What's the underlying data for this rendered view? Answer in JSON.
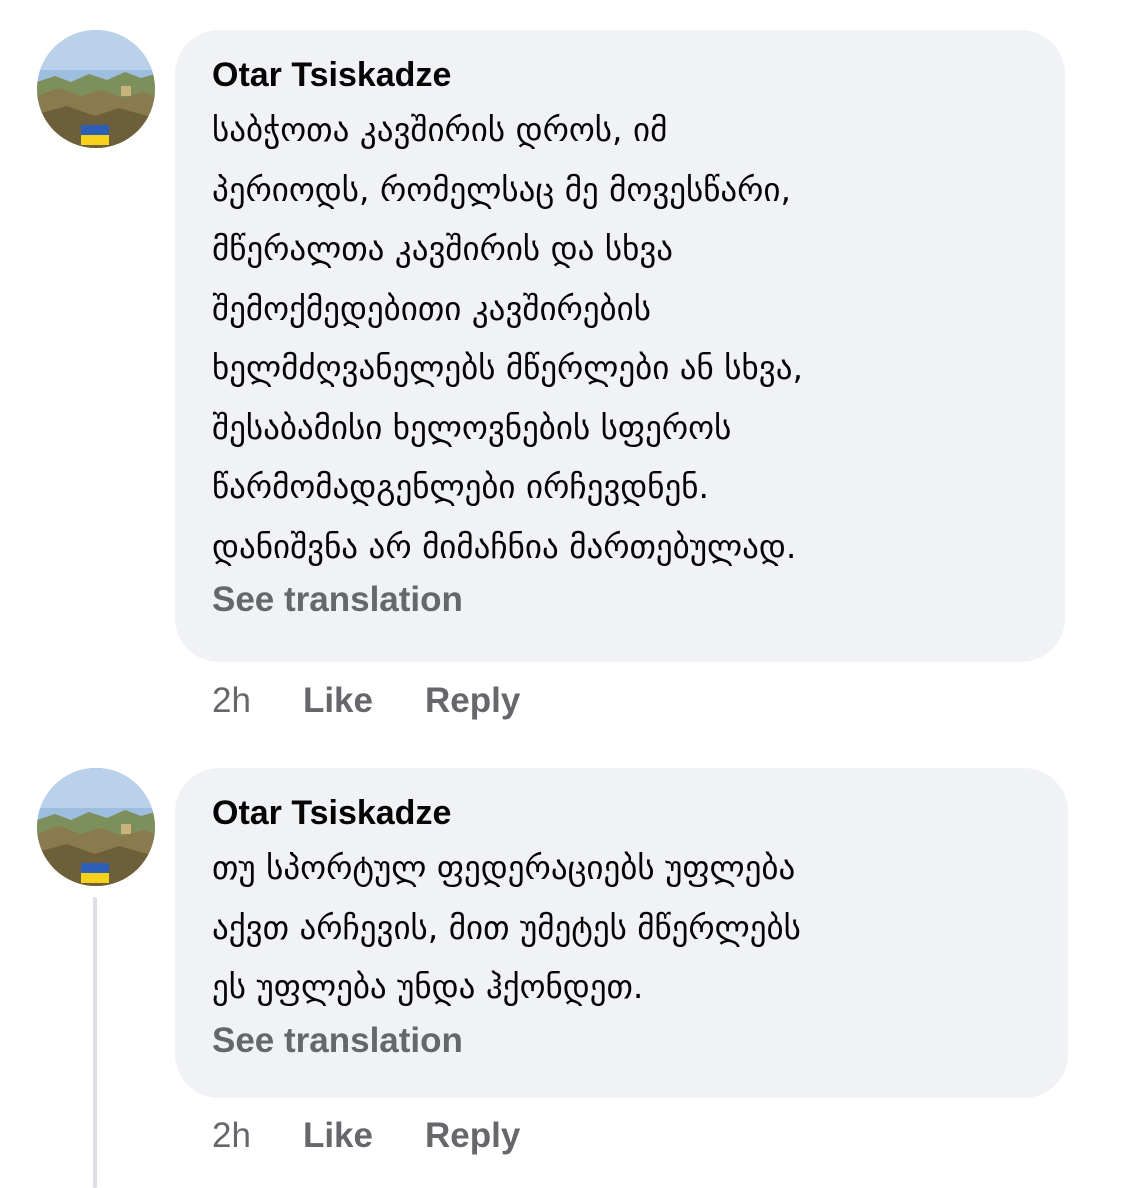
{
  "comments": [
    {
      "author": "Otar Tsiskadze",
      "text": "საბჭოთა კავშირის დროს, იმ\nპერიოდს, რომელსაც მე მოვესწარი,\nმწერალთა კავშირის და სხვა\nშემოქმედებითი კავშირების\nხელმძღვანელებს მწერლები ან სხვა,\nშესაბამისი ხელოვნების სფეროს\nწარმომადგენლები ირჩევდნენ.\nდანიშვნა არ მიმაჩნია მართებულად.",
      "see_translation": "See translation",
      "time": "2h",
      "like": "Like",
      "reply": "Reply",
      "avatar_icon": "profile-photo-with-flag-icon"
    },
    {
      "author": "Otar Tsiskadze",
      "text": "თუ სპორტულ ფედერაციებს უფლება\nაქვთ არჩევის, მით უმეტეს მწერლებს\nეს უფლება უნდა ჰქონდეთ.",
      "see_translation": "See translation",
      "time": "2h",
      "like": "Like",
      "reply": "Reply",
      "avatar_icon": "profile-photo-with-flag-icon"
    }
  ],
  "colors": {
    "bubble": "#f0f2f5",
    "text": "#050505",
    "secondary": "#65676b",
    "flag_blue": "#2d5fb8",
    "flag_yellow": "#f7d21a"
  }
}
